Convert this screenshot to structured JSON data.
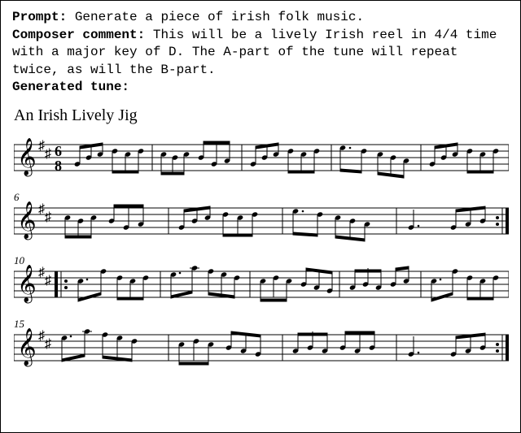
{
  "header": {
    "prompt_label": "Prompt:",
    "prompt_text": " Generate a piece of irish folk music.",
    "comment_label": "Composer comment:",
    "comment_text": " This will be a lively Irish reel in 4/4 time with a major key of D. The A-part of the tune will repeat twice, as will the B-part.",
    "generated_label": "Generated tune:"
  },
  "tune_title": "An Irish Lively Jig",
  "chart_data": {
    "type": "music-notation",
    "title": "An Irish Lively Jig",
    "time_signature": "6/8",
    "key": "D major (2 sharps)",
    "clef": "treble",
    "staves": [
      {
        "bar_start": 1,
        "has_clef": true,
        "has_time_sig": true,
        "start_repeat": false,
        "end_repeat": false
      },
      {
        "bar_start": 6,
        "has_clef": true,
        "has_time_sig": false,
        "start_repeat": false,
        "end_repeat": true
      },
      {
        "bar_start": 10,
        "has_clef": true,
        "has_time_sig": false,
        "start_repeat": true,
        "end_repeat": false
      },
      {
        "bar_start": 15,
        "has_clef": true,
        "has_time_sig": false,
        "start_repeat": false,
        "end_repeat": true
      }
    ]
  },
  "bar_labels": {
    "s2": "6",
    "s3": "10",
    "s4": "15"
  },
  "time_sig": {
    "top": "6",
    "bot": "8"
  }
}
